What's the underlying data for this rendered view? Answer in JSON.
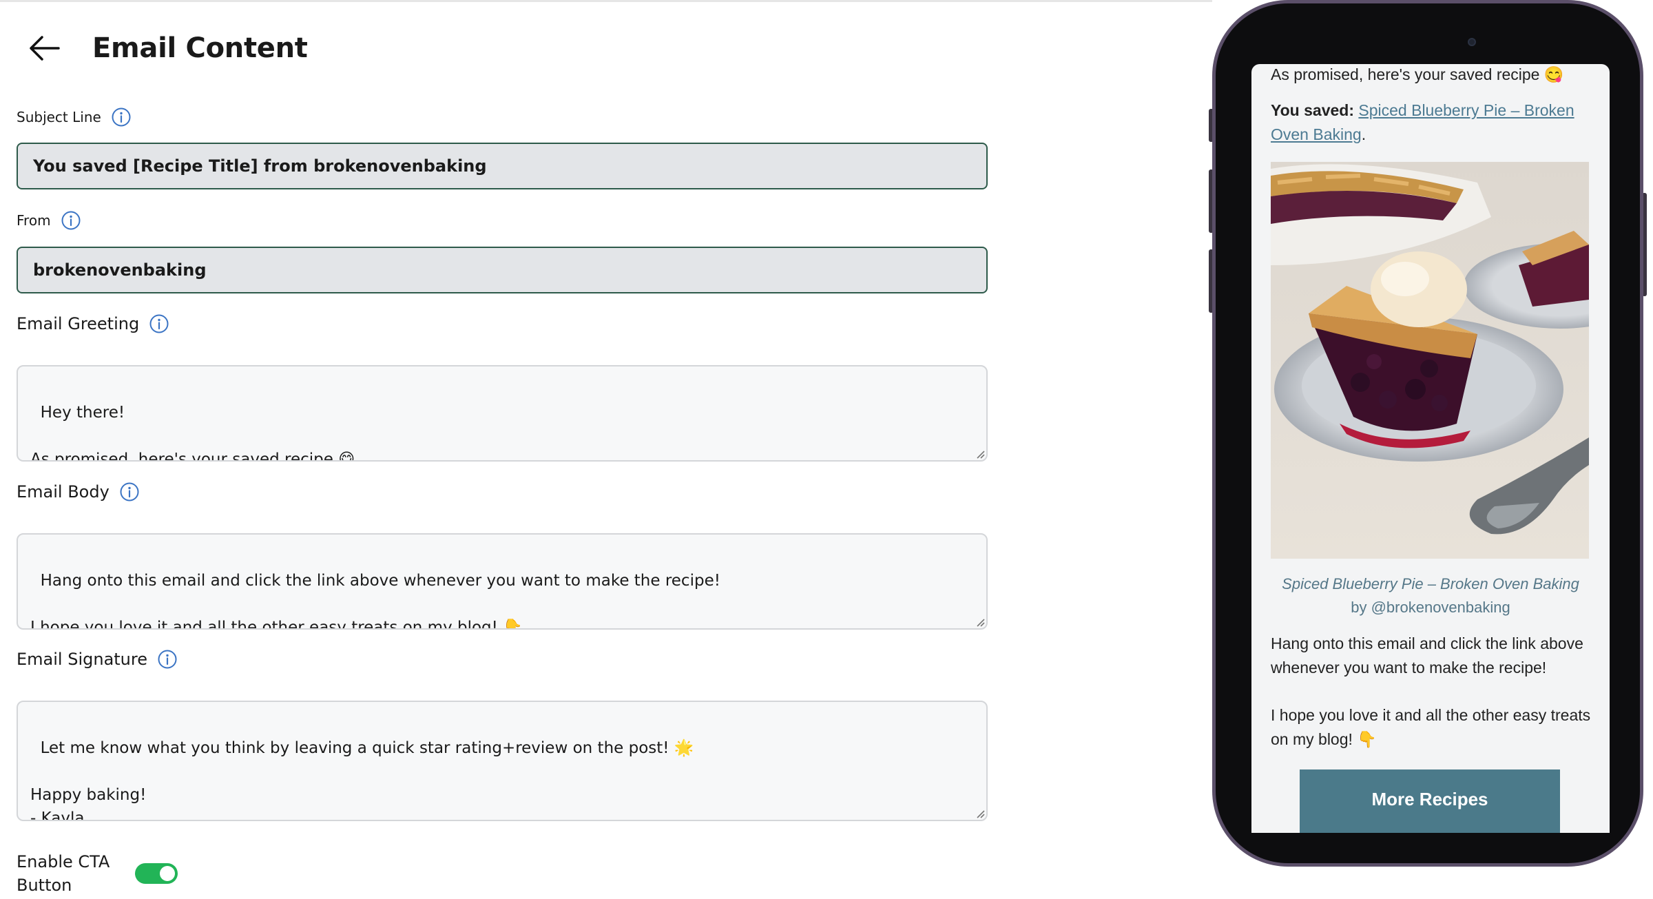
{
  "page": {
    "title": "Email Content"
  },
  "fields": {
    "subject": {
      "label": "Subject Line",
      "value": "You saved [Recipe Title] from brokenovenbaking"
    },
    "from": {
      "label": "From",
      "value": "brokenovenbaking"
    },
    "greeting": {
      "label": "Email Greeting",
      "value": "Hey there!\n\nAs promised, here's your saved recipe 😋"
    },
    "body": {
      "label": "Email Body",
      "value": "Hang onto this email and click the link above whenever you want to make the recipe!\n\nI hope you love it and all the other easy treats on my blog! 👇"
    },
    "signature": {
      "label": "Email Signature",
      "value": "Let me know what you think by leaving a quick star rating+review on the post! 🌟\n\nHappy baking!\n- Kayla"
    }
  },
  "cta_toggle": {
    "label": "Enable CTA Button",
    "enabled": true
  },
  "colors": {
    "accent": "#22b457",
    "input_border": "#2d5a4a",
    "cta_button": "#4b7a8a",
    "link": "#4c7a92",
    "info_icon": "#3b74c4"
  },
  "preview": {
    "intro": "As promised, here's your saved recipe 😋",
    "saved_prefix": "You saved:",
    "saved_link": "Spiced Blueberry Pie – Broken Oven Baking",
    "saved_suffix": ".",
    "caption_title": "Spiced Blueberry Pie – Broken Oven Baking",
    "caption_by": "by @brokenovenbaking",
    "body_p1": "Hang onto this email and click the link above whenever you want to make the recipe!",
    "body_p2": "I hope you love it and all the other easy treats on my blog! 👇",
    "cta_label": "More Recipes"
  },
  "icons": [
    "back-arrow-icon",
    "info-icon",
    "resize-grip-icon",
    "camera-icon"
  ]
}
